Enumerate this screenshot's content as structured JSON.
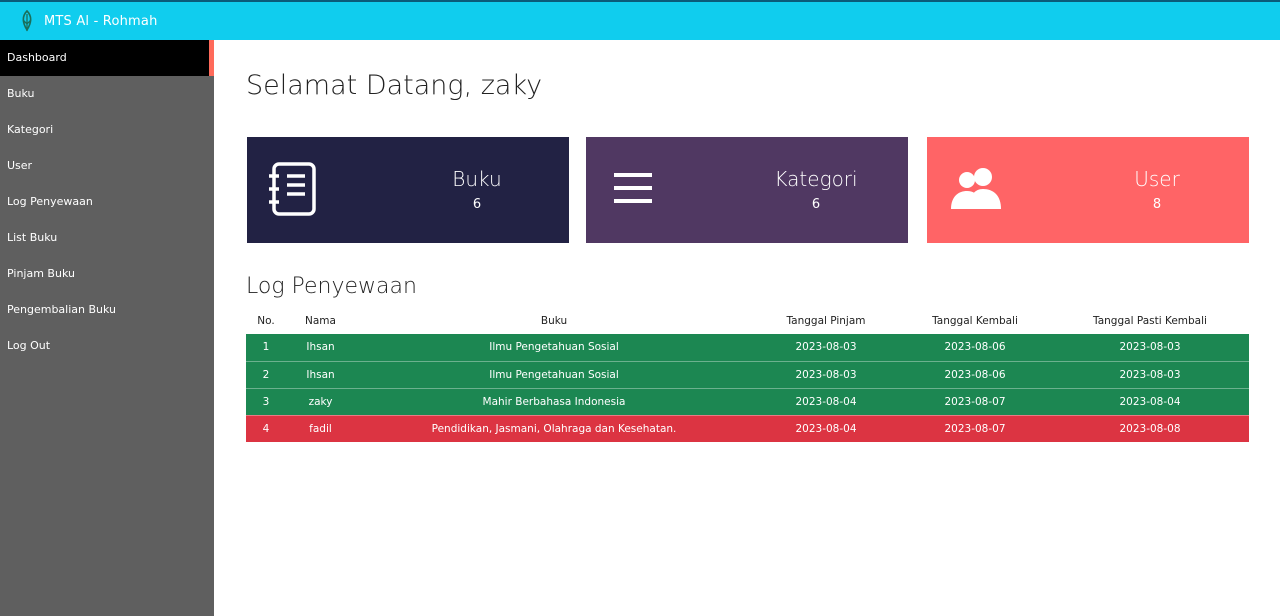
{
  "header": {
    "brand": "MTS Al - Rohmah"
  },
  "sidebar": {
    "items": [
      {
        "label": "Dashboard"
      },
      {
        "label": "Buku"
      },
      {
        "label": "Kategori"
      },
      {
        "label": "User"
      },
      {
        "label": "Log Penyewaan"
      },
      {
        "label": "List Buku"
      },
      {
        "label": "Pinjam Buku"
      },
      {
        "label": "Pengembalian Buku"
      },
      {
        "label": "Log Out"
      }
    ]
  },
  "main": {
    "welcome": "Selamat Datang, zaky",
    "cards": [
      {
        "title": "Buku",
        "count": "6",
        "icon": "book-list-icon",
        "color": "#222244"
      },
      {
        "title": "Kategori",
        "count": "6",
        "icon": "menu-lines-icon",
        "color": "#503862"
      },
      {
        "title": "User",
        "count": "8",
        "icon": "users-icon",
        "color": "#ff6466"
      }
    ],
    "log": {
      "title": "Log Penyewaan",
      "headers": [
        "No.",
        "Nama",
        "Buku",
        "Tanggal Pinjam",
        "Tanggal Kembali",
        "Tanggal Pasti Kembali"
      ],
      "rows": [
        [
          "1",
          "Ihsan",
          "Ilmu Pengetahuan Sosial",
          "2023-08-03",
          "2023-08-06",
          "2023-08-03"
        ],
        [
          "2",
          "Ihsan",
          "Ilmu Pengetahuan Sosial",
          "2023-08-03",
          "2023-08-06",
          "2023-08-03"
        ],
        [
          "3",
          "zaky",
          "Mahir Berbahasa Indonesia",
          "2023-08-04",
          "2023-08-07",
          "2023-08-04"
        ],
        [
          "4",
          "fadil",
          "Pendidikan, Jasmani, Olahraga dan Kesehatan.",
          "2023-08-04",
          "2023-08-07",
          "2023-08-08"
        ]
      ],
      "row_status": [
        "ok",
        "ok",
        "ok",
        "late"
      ],
      "status_colors": {
        "ok": "#1c8752",
        "late": "#dc3442"
      }
    }
  }
}
